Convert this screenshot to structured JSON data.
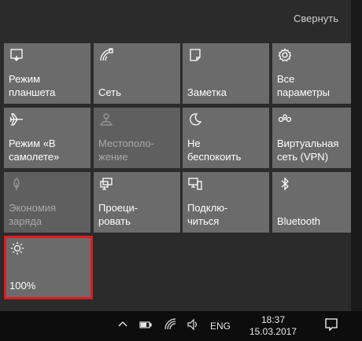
{
  "panel": {
    "collapse_label": "Свернуть"
  },
  "tiles": [
    {
      "label": "Режим\nпланшета",
      "icon": "tablet-mode-icon",
      "enabled": true
    },
    {
      "label": "Сеть",
      "icon": "network-icon",
      "enabled": true
    },
    {
      "label": "Заметка",
      "icon": "note-icon",
      "enabled": true
    },
    {
      "label": "Все\nпараметры",
      "icon": "gear-icon",
      "enabled": true
    },
    {
      "label": "Режим «В\nсамолете»",
      "icon": "airplane-icon",
      "enabled": true
    },
    {
      "label": "Местополо-\nжение",
      "icon": "location-icon",
      "enabled": false
    },
    {
      "label": "Не\nбеспокоить",
      "icon": "moon-icon",
      "enabled": true
    },
    {
      "label": "Виртуальная\nсеть (VPN)",
      "icon": "vpn-icon",
      "enabled": true
    },
    {
      "label": "Экономия\nзаряда",
      "icon": "battery-saver-icon",
      "enabled": false
    },
    {
      "label": "Проеци-\nровать",
      "icon": "project-icon",
      "enabled": true
    },
    {
      "label": "Подклю-\nчиться",
      "icon": "connect-icon",
      "enabled": true
    },
    {
      "label": "Bluetooth",
      "icon": "bluetooth-icon",
      "enabled": true
    },
    {
      "label": "100%",
      "icon": "brightness-icon",
      "enabled": true
    }
  ],
  "taskbar": {
    "language": "ENG",
    "time": "18:37",
    "date": "15.03.2017"
  },
  "colors": {
    "tile": "#6b6b6b",
    "highlight": "#e21b23",
    "panel": "#2b2b2b"
  }
}
